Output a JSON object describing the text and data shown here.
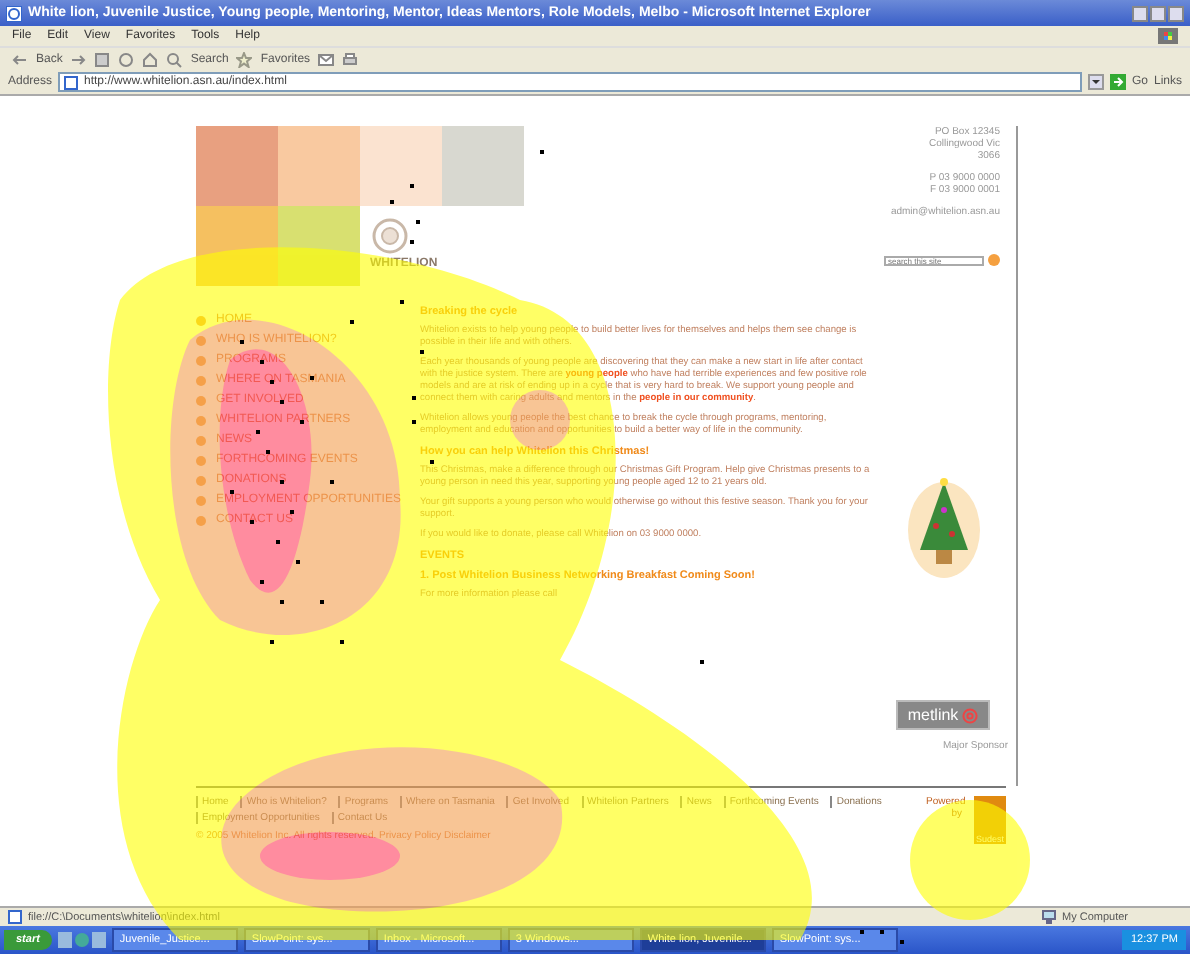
{
  "window": {
    "title": "White lion, Juvenile Justice, Young people, Mentoring, Mentor, Ideas Mentors, Role Models, Melbo - Microsoft Internet Explorer"
  },
  "menu": [
    "File",
    "Edit",
    "View",
    "Favorites",
    "Tools",
    "Help"
  ],
  "toolbar": {
    "buttons": [
      "Back",
      "Search",
      "Favorites"
    ]
  },
  "address_bar": {
    "label": "Address",
    "value": "http://www.whitelion.asn.au/index.html",
    "go": "Go",
    "links": "Links"
  },
  "site": {
    "logo_text": "WHITELION",
    "contact": [
      "PO Box 12345",
      "Collingwood Vic",
      "3066",
      "P  03 9000 0000",
      "F  03 9000 0001",
      "admin@whitelion.asn.au"
    ],
    "search": {
      "placeholder": "search this site"
    },
    "nav": [
      "HOME",
      "WHO IS WHITELION?",
      "PROGRAMS",
      "WHERE ON TASMANIA",
      "GET INVOLVED",
      "WHITELION PARTNERS",
      "NEWS",
      "FORTHCOMING EVENTS",
      "DONATIONS",
      "EMPLOYMENT OPPORTUNITIES",
      "CONTACT US"
    ],
    "sections": [
      {
        "kind": "heading",
        "text": "Breaking the cycle"
      },
      {
        "kind": "paragraph",
        "text": "Whitelion exists to help young people to build better lives for themselves and helps them see change is possible in their life and with others."
      },
      {
        "kind": "paragraph",
        "text": "Each year thousands of young people are discovering that they can make a new start in life after contact with the justice system. There are **young people** who have had terrible experiences and few positive role models and are at risk of ending up in a cycle that is very hard to break. We support young people and connect them with caring adults and mentors in the **people in our community**."
      },
      {
        "kind": "paragraph",
        "text": "Whitelion allows young people the best chance to break the cycle through programs, mentoring, employment and education and opportunities to build a better way of life in the community."
      },
      {
        "kind": "heading",
        "text": "How you can help Whitelion this Christmas!"
      },
      {
        "kind": "paragraph",
        "text": "This Christmas, make a difference through our Christmas Gift Program. Help give Christmas presents to a young person in need this year, supporting young people aged 12 to 21 years old."
      },
      {
        "kind": "paragraph",
        "text": "Your gift supports a young person who would otherwise go without this festive season. Thank you for your support."
      },
      {
        "kind": "paragraph",
        "text": "If you would like to donate, please call Whitelion on 03 9000 0000."
      },
      {
        "kind": "heading",
        "text": "EVENTS"
      },
      {
        "kind": "heading",
        "text": "1. Post Whitelion Business Networking Breakfast Coming Soon!"
      },
      {
        "kind": "paragraph",
        "text": "For more information please call"
      }
    ],
    "sponsor": {
      "logo": "metlink",
      "caption": "Major Sponsor"
    },
    "footer_links": [
      "Home",
      "Who is Whitelion?",
      "Programs",
      "Where on Tasmania",
      "Get Involved",
      "Whitelion Partners",
      "News",
      "Forthcoming Events",
      "Donations",
      "Employment Opportunities",
      "Contact Us"
    ],
    "copyright": "© 2005 Whitelion Inc. All rights reserved. Privacy Policy  Disclaimer",
    "powered_by": "Powered by",
    "badge": "Sudest"
  },
  "status_bar": {
    "text": "file://C:\\Documents\\whitelion\\index.html",
    "zone": "My Computer"
  },
  "taskbar": {
    "start": "start",
    "tasks": [
      {
        "label": "Juvenile_Justice...",
        "selected": false
      },
      {
        "label": "SlowPoint: sys...",
        "selected": false
      },
      {
        "label": "Inbox - Microsoft...",
        "selected": false
      },
      {
        "label": "3 Windows...",
        "selected": false
      },
      {
        "label": "White lion, Juvenile...",
        "selected": true
      },
      {
        "label": "SlowPoint: sys...",
        "selected": false
      }
    ],
    "clock": "12:37 PM"
  }
}
